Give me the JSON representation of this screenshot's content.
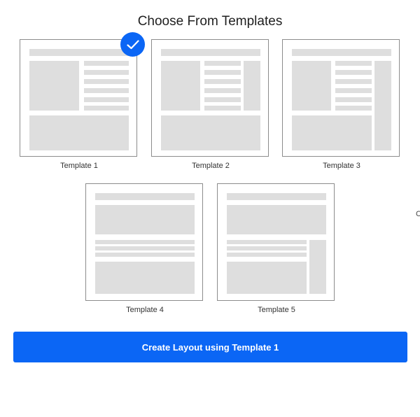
{
  "page_title": "Choose From Templates",
  "selected_icon": "checkmark-icon",
  "accent_color": "#0b66f5",
  "templates": [
    {
      "label": "Template 1",
      "selected": true
    },
    {
      "label": "Template 2",
      "selected": false
    },
    {
      "label": "Template 3",
      "selected": false
    },
    {
      "label": "Template 4",
      "selected": false
    },
    {
      "label": "Template 5",
      "selected": false
    }
  ],
  "create_button_label": "Create Layout using Template 1",
  "edge_text": "C"
}
